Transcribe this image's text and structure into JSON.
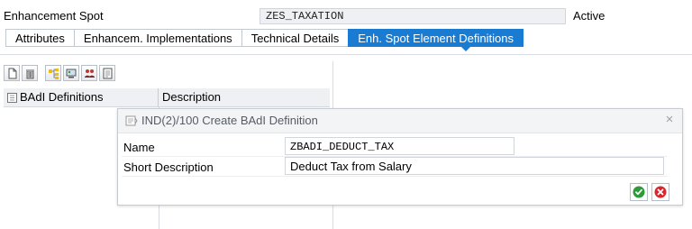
{
  "header": {
    "label": "Enhancement Spot",
    "value": "ZES_TAXATION",
    "status": "Active"
  },
  "tabs": [
    {
      "label": "Attributes",
      "active": false
    },
    {
      "label": "Enhancem. Implementations",
      "active": false
    },
    {
      "label": "Technical Details",
      "active": false
    },
    {
      "label": "Enh. Spot Element Definitions",
      "active": true
    }
  ],
  "toolbar": {
    "icons": [
      "create-icon",
      "delete-icon",
      "hierarchy-icon",
      "display-icon",
      "users-icon",
      "document-icon"
    ]
  },
  "table": {
    "columns": [
      "BAdI Definitions",
      "Description"
    ]
  },
  "dialog": {
    "title": "IND(2)/100 Create BAdI Definition",
    "close_symbol": "×",
    "fields": {
      "name_label": "Name",
      "name_value": "ZBADI_DEDUCT_TAX",
      "desc_label": "Short Description",
      "desc_value": "Deduct Tax from Salary"
    }
  },
  "colors": {
    "accent": "#1a7bd2",
    "ok": "#2e9b3a",
    "cancel": "#d9262d"
  }
}
